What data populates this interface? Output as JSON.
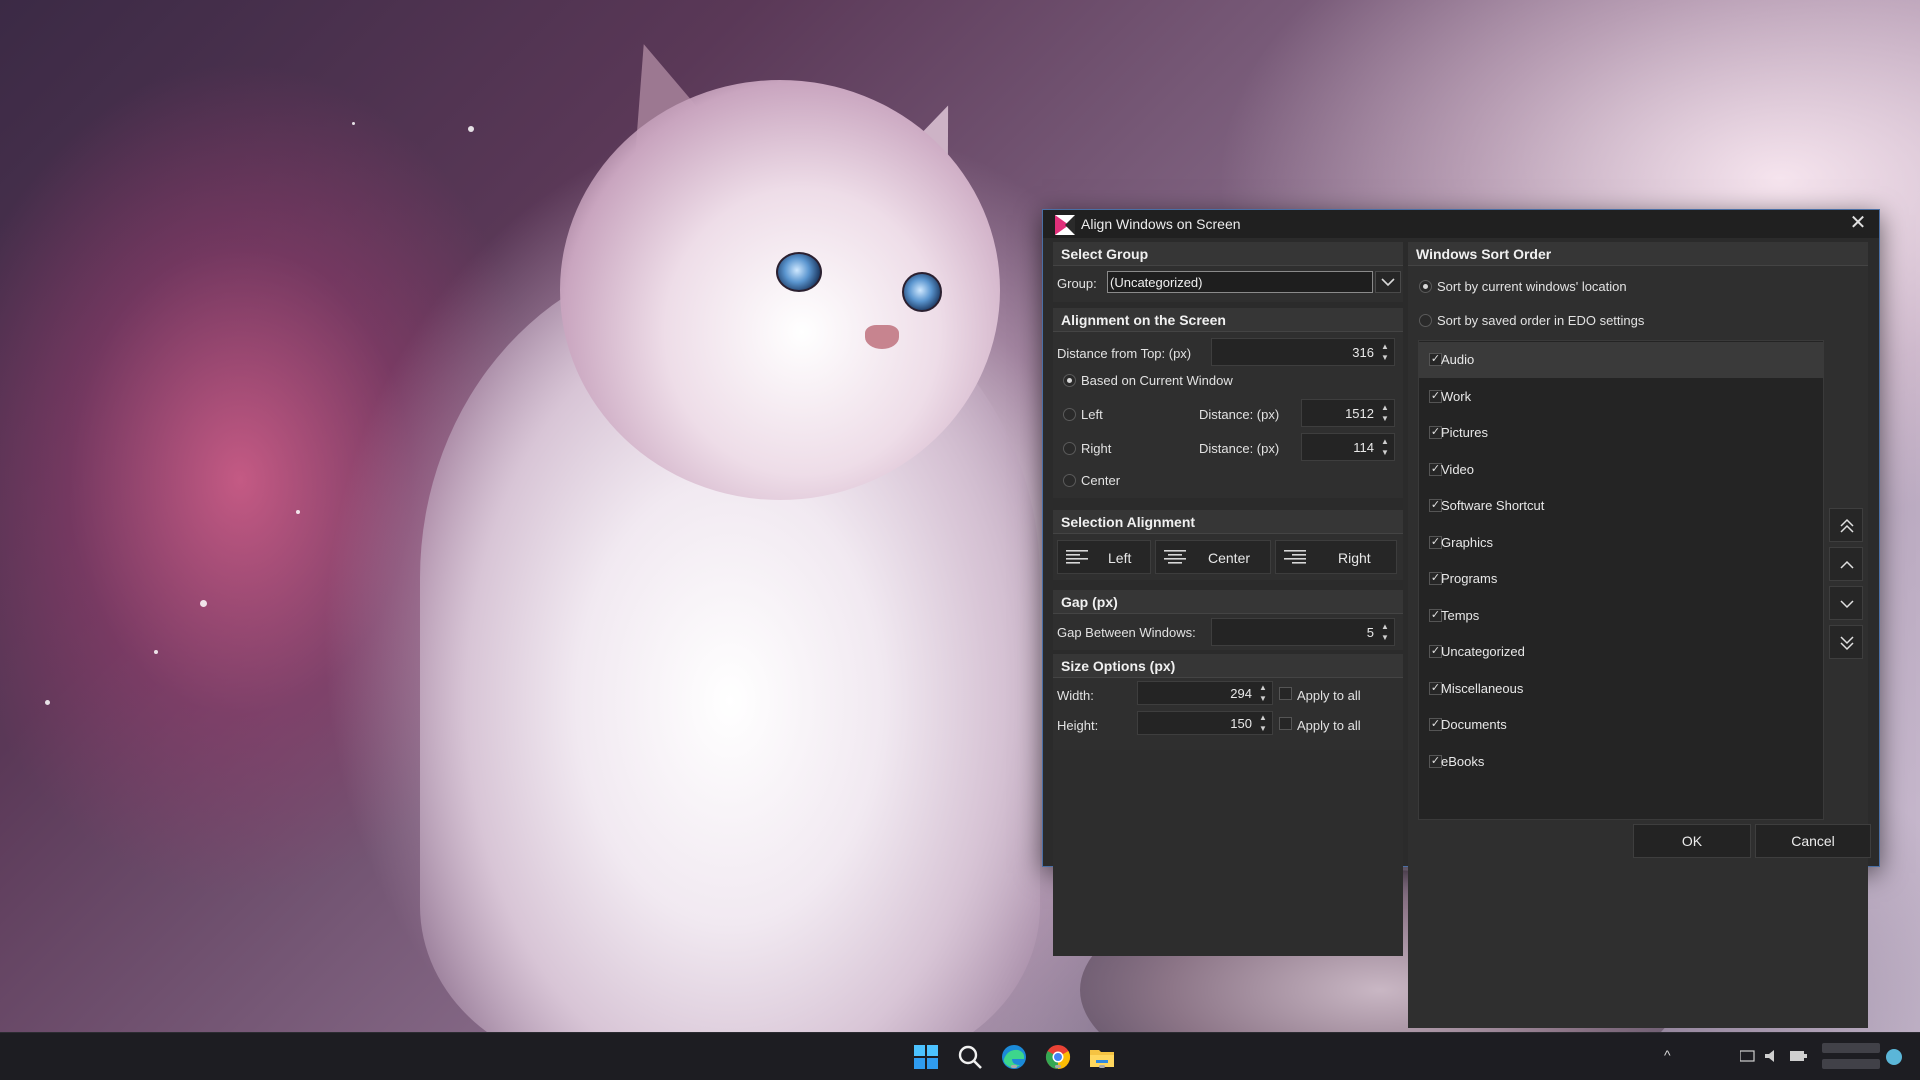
{
  "dialog": {
    "title": "Align Windows on Screen",
    "close_glyph": "✕",
    "select_group": {
      "heading": "Select Group",
      "group_label": "Group:",
      "group_value": "(Uncategorized)"
    },
    "alignment": {
      "heading": "Alignment on the Screen",
      "distance_top_label": "Distance from Top: (px)",
      "distance_top_value": "316",
      "based_on_current": "Based on Current Window",
      "left_label": "Left",
      "right_label": "Right",
      "center_label": "Center",
      "distance_label": "Distance: (px)",
      "left_distance_value": "1512",
      "right_distance_value": "114"
    },
    "selection_alignment": {
      "heading": "Selection Alignment",
      "left": "Left",
      "center": "Center",
      "right": "Right"
    },
    "gap": {
      "heading": "Gap (px)",
      "label": "Gap Between Windows:",
      "value": "5"
    },
    "size": {
      "heading": "Size Options (px)",
      "width_label": "Width:",
      "width_value": "294",
      "height_label": "Height:",
      "height_value": "150",
      "apply_all": "Apply to all"
    },
    "sort": {
      "heading": "Windows Sort Order",
      "option_location": "Sort by current windows' location",
      "option_saved": "Sort by saved order in EDO settings",
      "selected_option": "location",
      "items": [
        {
          "label": "Audio",
          "checked": true,
          "selected": true
        },
        {
          "label": "Work",
          "checked": true
        },
        {
          "label": "Pictures",
          "checked": true
        },
        {
          "label": "Video",
          "checked": true
        },
        {
          "label": "Software Shortcut",
          "checked": true
        },
        {
          "label": "Graphics",
          "checked": true
        },
        {
          "label": "Programs",
          "checked": true
        },
        {
          "label": "Temps",
          "checked": true
        },
        {
          "label": "Uncategorized",
          "checked": true
        },
        {
          "label": "Miscellaneous",
          "checked": true
        },
        {
          "label": "Documents",
          "checked": true
        },
        {
          "label": "eBooks",
          "checked": true
        }
      ],
      "move_buttons": [
        "move-top-icon",
        "move-up-icon",
        "move-down-icon",
        "move-bottom-icon"
      ]
    },
    "ok": "OK",
    "cancel": "Cancel"
  },
  "taskbar": {
    "icons": [
      "windows-start-icon",
      "search-icon",
      "edge-browser-icon",
      "chrome-browser-icon",
      "file-explorer-icon"
    ],
    "tray_chevron": "^"
  },
  "colors": {
    "dialog_bg": "#2b2b2b",
    "section_head_bg": "#363636",
    "accent_border": "#4a6fa5",
    "taskbar_bg": "#1d1d22"
  }
}
